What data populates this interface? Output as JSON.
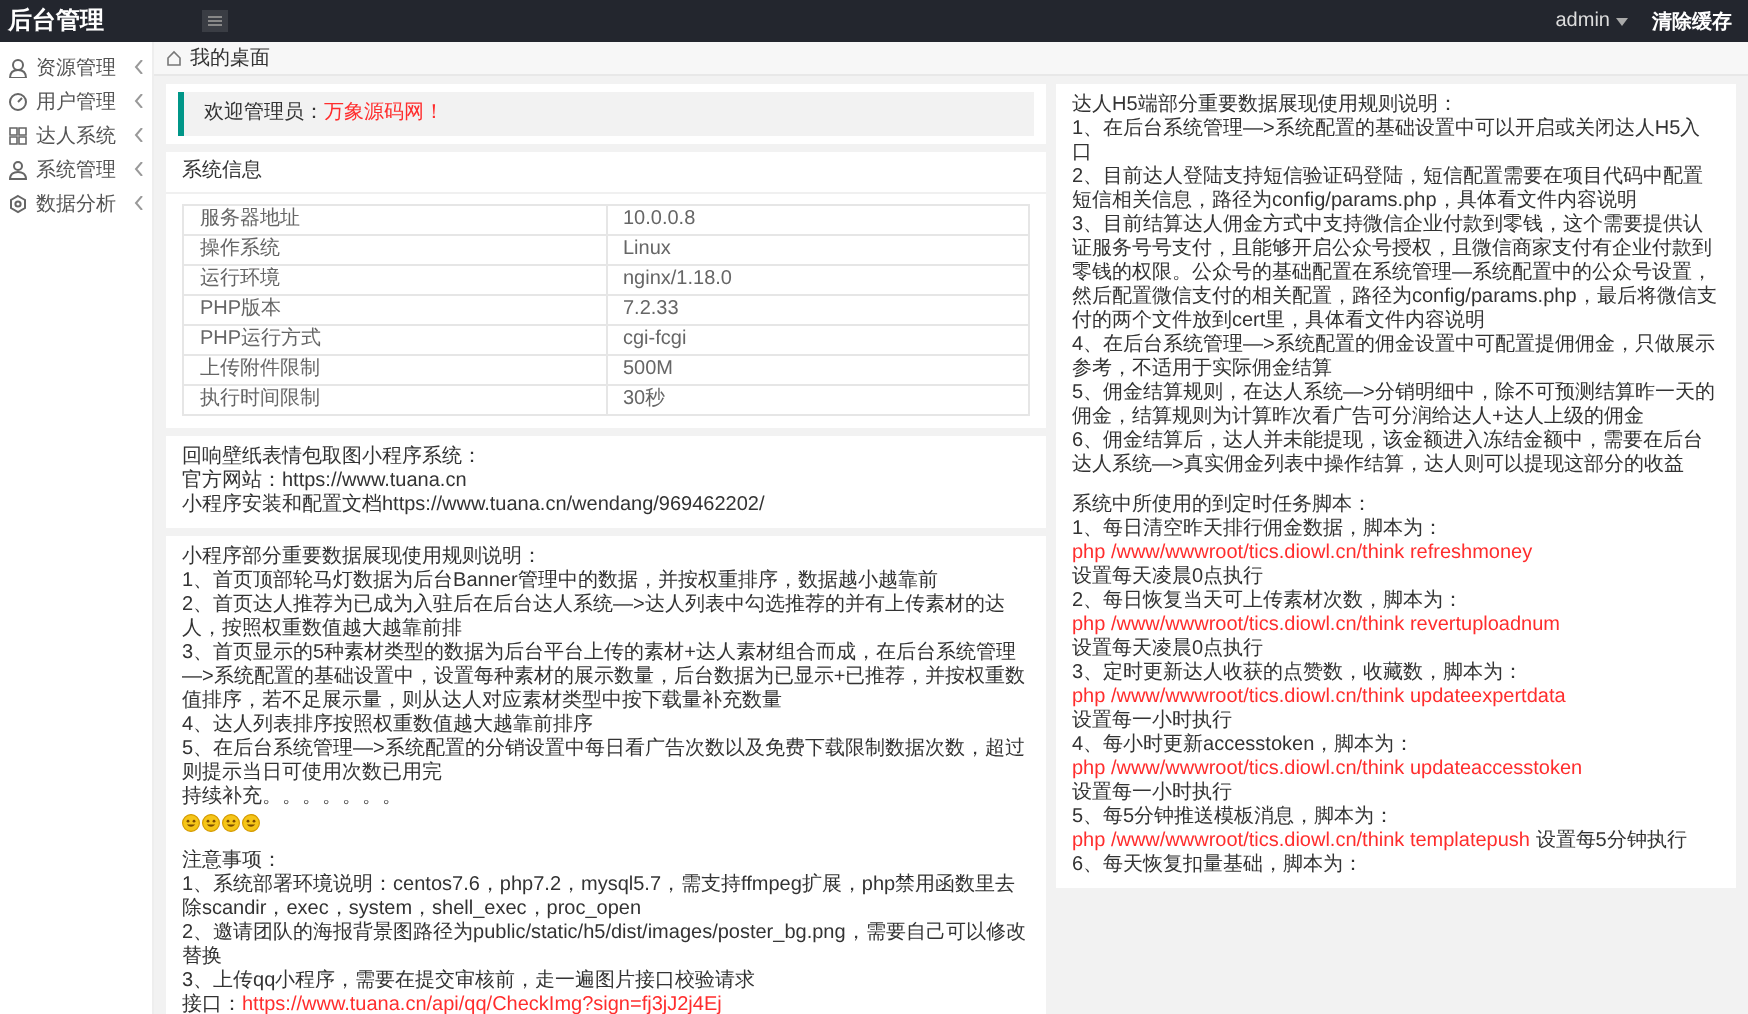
{
  "header": {
    "logo": "后台管理",
    "user": "admin",
    "clear_cache": "清除缓存"
  },
  "sidebar": {
    "items": [
      {
        "label": "资源管理",
        "expanded": false
      },
      {
        "label": "用户管理",
        "expanded": false
      },
      {
        "label": "达人系统",
        "expanded": false
      },
      {
        "label": "系统管理",
        "expanded": false
      },
      {
        "label": "数据分析",
        "expanded": false
      }
    ]
  },
  "breadcrumb": "我的桌面",
  "welcome": {
    "text": "欢迎管理员：",
    "highlight": "万象源码网！"
  },
  "system_info": {
    "title": "系统信息",
    "rows": [
      {
        "label": "服务器地址",
        "value": "10.0.0.8"
      },
      {
        "label": "操作系统",
        "value": "Linux"
      },
      {
        "label": "运行环境",
        "value": "nginx/1.18.0"
      },
      {
        "label": "PHP版本",
        "value": "7.2.33"
      },
      {
        "label": "PHP运行方式",
        "value": "cgi-fcgi"
      },
      {
        "label": "上传附件限制",
        "value": "500M"
      },
      {
        "label": "执行时间限制",
        "value": "30秒"
      }
    ]
  },
  "intro": {
    "lines": [
      {
        "kind": "text",
        "text": "回响壁纸表情包取图小程序系统："
      },
      {
        "kind": "text",
        "text": "官方网站：https://www.tuana.cn"
      },
      {
        "kind": "text",
        "text": "小程序安装和配置文档https://www.tuana.cn/wendang/969462202/"
      }
    ]
  },
  "miniapp_notes": {
    "lines": [
      {
        "kind": "text",
        "text": "小程序部分重要数据展现使用规则说明："
      },
      {
        "kind": "text",
        "text": "1、首页顶部轮马灯数据为后台Banner管理中的数据，并按权重排序，数据越小越靠前"
      },
      {
        "kind": "text",
        "text": "2、首页达人推荐为已成为入驻后在后台达人系统—>达人列表中勾选推荐的并有上传素材的达人，按照权重数值越大越靠前排"
      },
      {
        "kind": "text",
        "text": "3、首页显示的5种素材类型的数据为后台平台上传的素材+达人素材组合而成，在后台系统管理—>系统配置的基础设置中，设置每种素材的展示数量，后台数据为已显示+已推荐，并按权重数值排序，若不足展示量，则从达人对应素材类型中按下载量补充数量"
      },
      {
        "kind": "text",
        "text": "4、达人列表排序按照权重数值越大越靠前排序"
      },
      {
        "kind": "text",
        "text": "5、在后台系统管理—>系统配置的分销设置中每日看广告次数以及免费下载限制数据次数，超过则提示当日可使用次数已用完"
      },
      {
        "kind": "text",
        "text": "持续补充。。。。。。。"
      },
      {
        "kind": "emoji"
      },
      {
        "kind": "gap"
      },
      {
        "kind": "text",
        "text": "注意事项："
      },
      {
        "kind": "text",
        "text": "1、系统部署环境说明：centos7.6，php7.2，mysql5.7，需支持ffmpeg扩展，php禁用函数里去除scandir，exec，system，shell_exec，proc_open"
      },
      {
        "kind": "text",
        "text": "2、邀请团队的海报背景图路径为public/static/h5/dist/images/poster_bg.png，需要自己可以修改替换"
      },
      {
        "kind": "text",
        "text": "3、上传qq小程序，需要在提交审核前，走一遍图片接口校验请求"
      },
      {
        "kind": "link",
        "text": "接口：",
        "link": "https://www.tuana.cn/api/qq/CheckImg?sign=fj3jJ2j4Ej"
      }
    ]
  },
  "h5_notes": {
    "lines": [
      {
        "kind": "text",
        "text": "达人H5端部分重要数据展现使用规则说明："
      },
      {
        "kind": "text",
        "text": "1、在后台系统管理—>系统配置的基础设置中可以开启或关闭达人H5入口"
      },
      {
        "kind": "text",
        "text": "2、目前达人登陆支持短信验证码登陆，短信配置需要在项目代码中配置短信相关信息，路径为config/params.php，具体看文件内容说明"
      },
      {
        "kind": "text",
        "text": "3、目前结算达人佣金方式中支持微信企业付款到零钱，这个需要提供认证服务号号支付，且能够开启公众号授权，且微信商家支付有企业付款到零钱的权限。公众号的基础配置在系统管理—系统配置中的公众号设置，然后配置微信支付的相关配置，路径为config/params.php，最后将微信支付的两个文件放到cert里，具体看文件内容说明"
      },
      {
        "kind": "text",
        "text": "4、在后台系统管理—>系统配置的佣金设置中可配置提佣佣金，只做展示参考，不适用于实际佣金结算"
      },
      {
        "kind": "text",
        "text": "5、佣金结算规则，在达人系统—>分销明细中，除不可预测结算昨一天的佣金，结算规则为计算昨次看广告可分润给达人+达人上级的佣金"
      },
      {
        "kind": "text",
        "text": "6、佣金结算后，达人并未能提现，该金额进入冻结金额中，需要在后台达人系统—>真实佣金列表中操作结算，达人则可以提现这部分的收益"
      },
      {
        "kind": "gap"
      },
      {
        "kind": "text",
        "text": "系统中所使用的到定时任务脚本："
      },
      {
        "kind": "text",
        "text": "1、每日清空昨天排行佣金数据，脚本为："
      },
      {
        "kind": "command",
        "command": "php /www/wwwroot/tics.diowl.cn/think refreshmoney",
        "note": "设置每天凌晨0点执行"
      },
      {
        "kind": "text",
        "text": "2、每日恢复当天可上传素材次数，脚本为："
      },
      {
        "kind": "command",
        "command": "php /www/wwwroot/tics.diowl.cn/think revertuploadnum",
        "note": "设置每天凌晨0点执行"
      },
      {
        "kind": "text",
        "text": "3、定时更新达人收获的点赞数，收藏数，脚本为："
      },
      {
        "kind": "command",
        "command": "php /www/wwwroot/tics.diowl.cn/think updateexpertdata",
        "note": "设置每一小时执行"
      },
      {
        "kind": "text",
        "text": "4、每小时更新accesstoken，脚本为："
      },
      {
        "kind": "command",
        "command": "php /www/wwwroot/tics.diowl.cn/think updateaccesstoken",
        "note": "设置每一小时执行"
      },
      {
        "kind": "text",
        "text": "5、每5分钟推送模板消息，脚本为："
      },
      {
        "kind": "command",
        "command": "php /www/wwwroot/tics.diowl.cn/think templatepush",
        "note": "设置每5分钟执行"
      },
      {
        "kind": "text",
        "text": "6、每天恢复扣量基础，脚本为："
      }
    ]
  }
}
